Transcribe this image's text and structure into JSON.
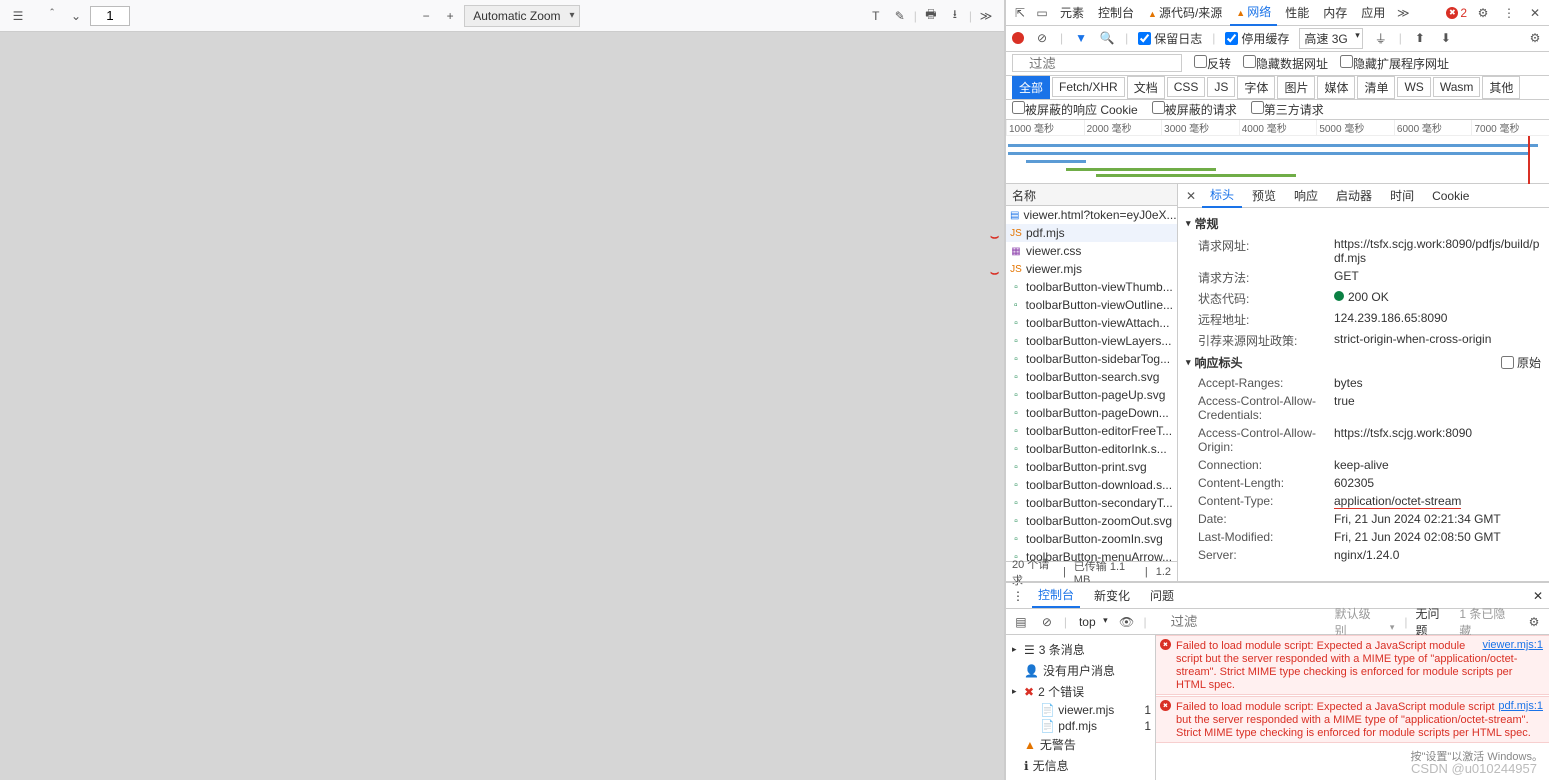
{
  "pdf": {
    "page": "1",
    "zoom": "Automatic Zoom"
  },
  "devtabs": [
    "元素",
    "控制台",
    "源代码/来源",
    "网络",
    "性能",
    "内存",
    "应用"
  ],
  "devtabs_sel": 3,
  "errcount": "2",
  "net": {
    "preserve": "保留日志",
    "disable_cache": "停用缓存",
    "throttle": "高速 3G"
  },
  "filter_ph": "过滤",
  "filter_cb": {
    "invert": "反转",
    "hide_data": "隐藏数据网址",
    "hide_ext": "隐藏扩展程序网址"
  },
  "types": [
    "全部",
    "Fetch/XHR",
    "文档",
    "CSS",
    "JS",
    "字体",
    "图片",
    "媒体",
    "清单",
    "WS",
    "Wasm",
    "其他"
  ],
  "cookies": [
    "被屏蔽的响应 Cookie",
    "被屏蔽的请求",
    "第三方请求"
  ],
  "ticks": [
    "1000 毫秒",
    "2000 毫秒",
    "3000 毫秒",
    "4000 毫秒",
    "5000 毫秒",
    "6000 毫秒",
    "7000 毫秒"
  ],
  "reqhdr": "名称",
  "reqs": [
    {
      "n": "viewer.html?token=eyJ0eX...",
      "t": "doc"
    },
    {
      "n": "pdf.mjs",
      "t": "js",
      "sel": true,
      "mark": true
    },
    {
      "n": "viewer.css",
      "t": "css"
    },
    {
      "n": "viewer.mjs",
      "t": "js",
      "mark": true
    },
    {
      "n": "toolbarButton-viewThumb...",
      "t": "img"
    },
    {
      "n": "toolbarButton-viewOutline...",
      "t": "img"
    },
    {
      "n": "toolbarButton-viewAttach...",
      "t": "img"
    },
    {
      "n": "toolbarButton-viewLayers...",
      "t": "img"
    },
    {
      "n": "toolbarButton-sidebarTog...",
      "t": "img"
    },
    {
      "n": "toolbarButton-search.svg",
      "t": "img"
    },
    {
      "n": "toolbarButton-pageUp.svg",
      "t": "img"
    },
    {
      "n": "toolbarButton-pageDown...",
      "t": "img"
    },
    {
      "n": "toolbarButton-editorFreeT...",
      "t": "img"
    },
    {
      "n": "toolbarButton-editorInk.s...",
      "t": "img"
    },
    {
      "n": "toolbarButton-print.svg",
      "t": "img"
    },
    {
      "n": "toolbarButton-download.s...",
      "t": "img"
    },
    {
      "n": "toolbarButton-secondaryT...",
      "t": "img"
    },
    {
      "n": "toolbarButton-zoomOut.svg",
      "t": "img"
    },
    {
      "n": "toolbarButton-zoomIn.svg",
      "t": "img"
    },
    {
      "n": "toolbarButton-menuArrow...",
      "t": "img"
    }
  ],
  "reqfoot": {
    "count": "20 个请求",
    "xfer": "已传输 1.1 MB",
    "res": "1.2"
  },
  "dtabs": [
    "标头",
    "预览",
    "响应",
    "启动器",
    "时间",
    "Cookie"
  ],
  "general_h": "常规",
  "general": [
    {
      "k": "请求网址:",
      "v": "https://tsfx.scjg.work:8090/pdfjs/build/pdf.mjs"
    },
    {
      "k": "请求方法:",
      "v": "GET"
    },
    {
      "k": "状态代码:",
      "v": "200 OK",
      "dot": true
    },
    {
      "k": "远程地址:",
      "v": "124.239.186.65:8090"
    },
    {
      "k": "引荐来源网址政策:",
      "v": "strict-origin-when-cross-origin"
    }
  ],
  "resp_h": "响应标头",
  "raw": "原始",
  "resp": [
    {
      "k": "Accept-Ranges:",
      "v": "bytes"
    },
    {
      "k": "Access-Control-Allow-Credentials:",
      "v": "true"
    },
    {
      "k": "Access-Control-Allow-Origin:",
      "v": "https://tsfx.scjg.work:8090"
    },
    {
      "k": "Connection:",
      "v": "keep-alive"
    },
    {
      "k": "Content-Length:",
      "v": "602305"
    },
    {
      "k": "Content-Type:",
      "v": "application/octet-stream",
      "ul": true
    },
    {
      "k": "Date:",
      "v": "Fri, 21 Jun 2024 02:21:34 GMT"
    },
    {
      "k": "Last-Modified:",
      "v": "Fri, 21 Jun 2024 02:08:50 GMT"
    },
    {
      "k": "Server:",
      "v": "nginx/1.24.0"
    }
  ],
  "drawer_tabs": [
    "控制台",
    "新变化",
    "问题"
  ],
  "ctb": {
    "scope": "top",
    "filter": "过滤",
    "level": "默认级别",
    "noissue": "无问题",
    "hidden": "1 条已隐藏"
  },
  "side": {
    "msgs": "3 条消息",
    "nouser": "没有用户消息",
    "errs": "2 个错误",
    "f1": "viewer.mjs",
    "f2": "pdf.mjs",
    "c": "1",
    "nowarn": "无警告",
    "noinfo": "无信息"
  },
  "err1": {
    "src": "viewer.mjs:1",
    "txt": "Failed to load module script: Expected a JavaScript module script but the server responded with a MIME type of \"application/octet-stream\". Strict MIME type checking is enforced for module scripts per HTML spec."
  },
  "err2": {
    "src": "pdf.mjs:1",
    "txt": "Failed to load module script: Expected a JavaScript module script but the server responded with a MIME type of \"application/octet-stream\". Strict MIME type checking is enforced for module scripts per HTML spec."
  },
  "water": "CSDN @u010244957",
  "winact": "按\"设置\"以激活 Windows。"
}
